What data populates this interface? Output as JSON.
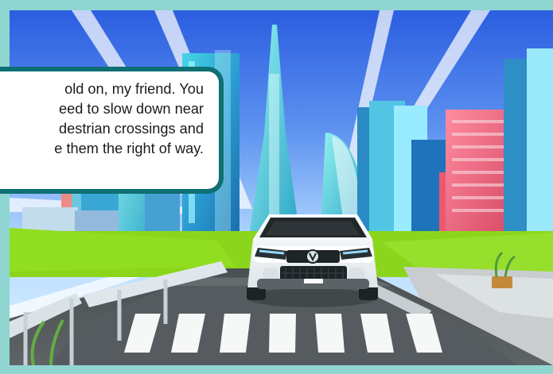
{
  "speech_bubble": {
    "text": "old on, my friend. You\need to slow down near\ndestrian crossings and\ne them the right of way."
  },
  "colors": {
    "border": "#8fd6d1",
    "bubble_border": "#0f6f73",
    "sky_top": "#2b5de0",
    "road": "#525859",
    "grass": "#8bd61c",
    "car": "#f3f6f8"
  }
}
